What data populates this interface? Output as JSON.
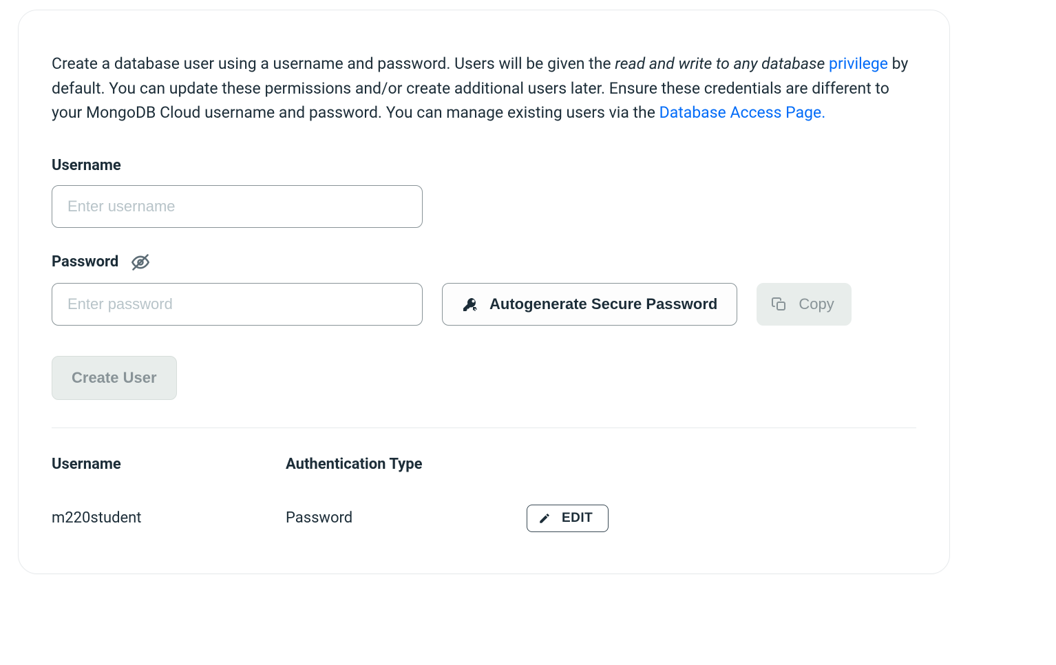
{
  "description": {
    "part1": "Create a database user using a username and password. Users will be given the ",
    "part1_em": "read and write to any database",
    "part2_link": "privilege",
    "part3": " by default. You can update these permissions and/or create additional users later. Ensure these credentials are different to your MongoDB Cloud username and password. You can manage existing users via the ",
    "part3_link": "Database Access Page."
  },
  "form": {
    "username_label": "Username",
    "username_placeholder": "Enter username",
    "username_value": "",
    "password_label": "Password",
    "password_placeholder": "Enter password",
    "password_value": "",
    "autogenerate_label": "Autogenerate Secure Password",
    "copy_label": "Copy",
    "create_user_label": "Create User"
  },
  "user_list": {
    "header_username": "Username",
    "header_auth_type": "Authentication Type",
    "rows": [
      {
        "username": "m220student",
        "auth_type": "Password",
        "edit_label": "EDIT"
      }
    ]
  }
}
